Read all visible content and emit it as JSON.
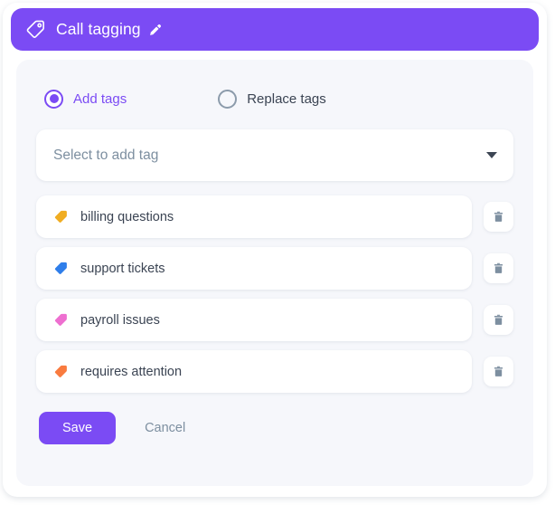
{
  "header": {
    "title": "Call tagging",
    "tag_icon": "tag-icon",
    "edit_icon": "pencil-icon",
    "background_color": "#7B4BF4",
    "text_color": "#FFFFFF"
  },
  "mode": {
    "selected": "add",
    "options": [
      {
        "id": "add",
        "label": "Add tags",
        "selected": true
      },
      {
        "id": "replace",
        "label": "Replace tags",
        "selected": false
      }
    ],
    "selected_color": "#7B4BF4",
    "unselected_color": "#8C9BAB"
  },
  "select": {
    "placeholder": "Select to add tag",
    "value": "",
    "caret_icon": "chevron-down-icon"
  },
  "tags": [
    {
      "label": "billing questions",
      "color": "#F0AD22",
      "icon": "tag-icon",
      "delete_icon": "trash-icon"
    },
    {
      "label": "support tickets",
      "color": "#2F7EEA",
      "icon": "tag-icon",
      "delete_icon": "trash-icon"
    },
    {
      "label": "payroll issues",
      "color": "#EE6FD0",
      "icon": "tag-icon",
      "delete_icon": "trash-icon"
    },
    {
      "label": "requires attention",
      "color": "#F97B3F",
      "icon": "tag-icon",
      "delete_icon": "trash-icon"
    }
  ],
  "footer": {
    "save_label": "Save",
    "cancel_label": "Cancel",
    "save_color": "#7B4BF4",
    "cancel_color": "#7D8FA0"
  }
}
